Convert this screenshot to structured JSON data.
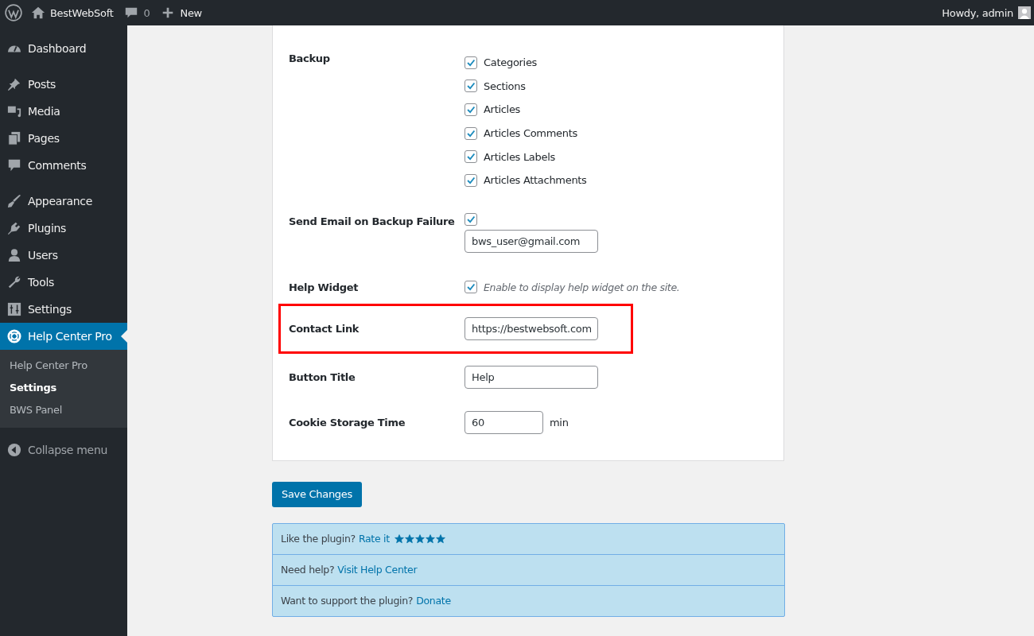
{
  "admin_bar": {
    "site_name": "BestWebSoft",
    "comments_count": "0",
    "new_label": "New",
    "greeting": "Howdy, admin"
  },
  "sidebar": {
    "groups": [
      [
        {
          "label": "Dashboard",
          "selected": false
        }
      ],
      [
        {
          "label": "Posts",
          "selected": false
        },
        {
          "label": "Media",
          "selected": false
        },
        {
          "label": "Pages",
          "selected": false
        },
        {
          "label": "Comments",
          "selected": false
        }
      ],
      [
        {
          "label": "Appearance",
          "selected": false
        },
        {
          "label": "Plugins",
          "selected": false
        },
        {
          "label": "Users",
          "selected": false
        },
        {
          "label": "Tools",
          "selected": false
        },
        {
          "label": "Settings",
          "selected": false
        },
        {
          "label": "Help Center Pro",
          "selected": true,
          "children": [
            {
              "label": "Help Center Pro",
              "selected": false
            },
            {
              "label": "Settings",
              "selected": true
            },
            {
              "label": "BWS Panel",
              "selected": false
            }
          ]
        }
      ]
    ],
    "collapse_label": "Collapse menu"
  },
  "settings": [
    {
      "kind": "checklist",
      "label": "Backup",
      "options": [
        {
          "label": "Categories",
          "checked": true
        },
        {
          "label": "Sections",
          "checked": true
        },
        {
          "label": "Articles",
          "checked": true
        },
        {
          "label": "Articles Comments",
          "checked": true
        },
        {
          "label": "Articles Labels",
          "checked": true
        },
        {
          "label": "Articles Attachments",
          "checked": true
        }
      ]
    },
    {
      "kind": "checkbox_field",
      "label": "Send Email on Backup Failure",
      "checked": true,
      "value": "bws_user@gmail.com"
    },
    {
      "kind": "checkbox_hint",
      "label": "Help Widget",
      "checked": true,
      "hint": "Enable to display help widget on the site."
    },
    {
      "kind": "text",
      "label": "Contact Link",
      "value": "https://bestwebsoft.com",
      "highlighted": true
    },
    {
      "kind": "text",
      "label": "Button Title",
      "value": "Help",
      "highlighted": false
    },
    {
      "kind": "number",
      "label": "Cookie Storage Time",
      "value": "60",
      "unit": "min"
    }
  ],
  "save_button": "Save Changes",
  "info_rows": [
    {
      "text": "Like the plugin?",
      "link": "Rate it",
      "stars": 5
    },
    {
      "text": "Need help?",
      "link": "Visit Help Center"
    },
    {
      "text": "Want to support the plugin?",
      "link": "Donate"
    }
  ]
}
